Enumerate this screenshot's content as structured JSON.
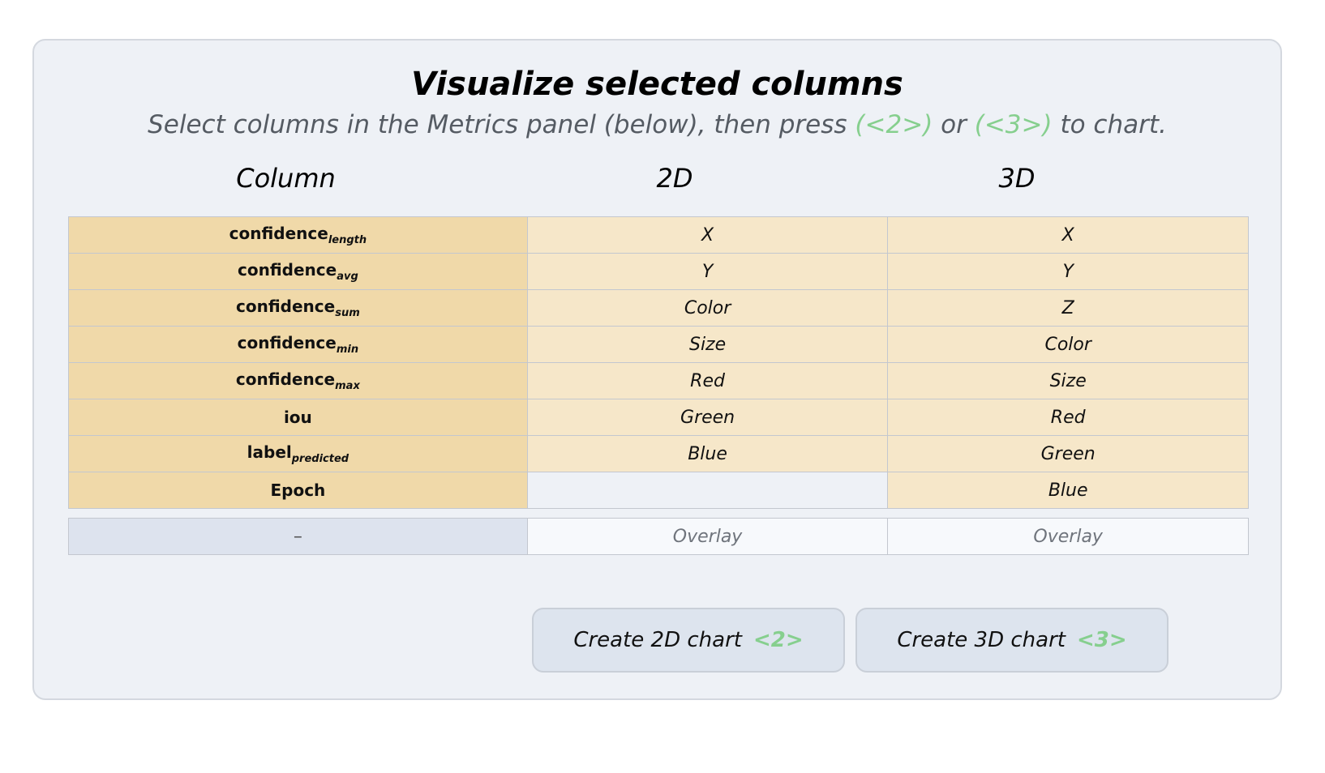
{
  "title": "Visualize selected columns",
  "subtitle": {
    "before": "Select columns in the Metrics panel (below), then press ",
    "key2": "(<2>)",
    "middle": " or ",
    "key3": "(<3>)",
    "after": " to chart."
  },
  "headers": {
    "column": "Column",
    "two_d": "2D",
    "three_d": "3D"
  },
  "rows": [
    {
      "name": "confidence",
      "sub": "length",
      "two_d": "X",
      "three_d": "X"
    },
    {
      "name": "confidence",
      "sub": "avg",
      "two_d": "Y",
      "three_d": "Y"
    },
    {
      "name": "confidence",
      "sub": "sum",
      "two_d": "Color",
      "three_d": "Z"
    },
    {
      "name": "confidence",
      "sub": "min",
      "two_d": "Size",
      "three_d": "Color"
    },
    {
      "name": "confidence",
      "sub": "max",
      "two_d": "Red",
      "three_d": "Size"
    },
    {
      "name": "iou",
      "sub": "",
      "two_d": "Green",
      "three_d": "Red"
    },
    {
      "name": "label",
      "sub": "predicted",
      "two_d": "Blue",
      "three_d": "Green"
    },
    {
      "name": "Epoch",
      "sub": "",
      "two_d": "",
      "three_d": "Blue"
    }
  ],
  "overlay_row": {
    "name": "–",
    "two_d": "Overlay",
    "three_d": "Overlay"
  },
  "buttons": {
    "create_2d": {
      "label": "Create 2D chart",
      "shortcut": "<2>"
    },
    "create_3d": {
      "label": "Create 3D chart",
      "shortcut": "<3>"
    }
  },
  "colors": {
    "panel_bg": "#eef1f6",
    "column_cell": "#f0d9a9",
    "assigned_cell": "#f6e7c9",
    "shortcut_green": "#86cf8e",
    "axis_x": "#c0463a",
    "axis_y": "#5aaa6d",
    "axis_z": "#4f7fbf"
  }
}
